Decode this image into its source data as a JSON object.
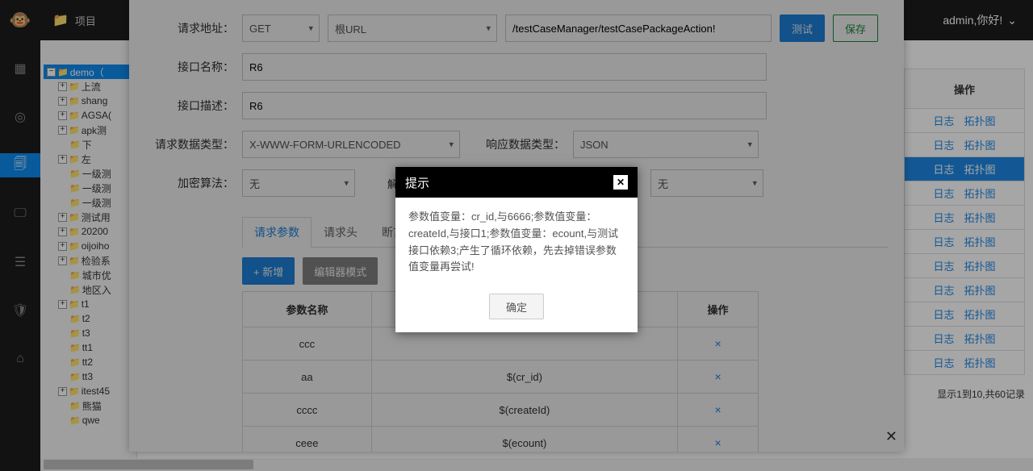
{
  "topbar": {
    "project_label": "项目",
    "user_label": "admin,你好!"
  },
  "rail_icons": [
    "dashboard",
    "target",
    "doc",
    "monitor",
    "list",
    "shield",
    "home"
  ],
  "tree": {
    "root": "demo（",
    "nodes": [
      {
        "label": "上流",
        "children": []
      },
      {
        "label": "shang",
        "children": []
      },
      {
        "label": "AGSA(",
        "children": []
      },
      {
        "label": "apk测",
        "children": [
          {
            "label": "下"
          }
        ]
      },
      {
        "label": "左",
        "children": [
          {
            "label": "一级测"
          },
          {
            "label": "一级测"
          },
          {
            "label": "一级测"
          }
        ]
      },
      {
        "label": "测试用",
        "children": []
      },
      {
        "label": "20200",
        "children": []
      },
      {
        "label": "oijoiho",
        "children": []
      },
      {
        "label": "检验系",
        "children": [
          {
            "label": "城市优"
          },
          {
            "label": "地区入"
          }
        ]
      },
      {
        "label": "t1",
        "children": [
          {
            "label": "t2"
          },
          {
            "label": "t3"
          },
          {
            "label": "tt1"
          },
          {
            "label": "tt2"
          },
          {
            "label": "tt3"
          }
        ]
      },
      {
        "label": "itest45",
        "children": [
          {
            "label": "熊猫"
          },
          {
            "label": "qwe"
          }
        ]
      }
    ]
  },
  "rightpane": {
    "header": "操作",
    "log_label": "日志",
    "topo_label": "拓扑图",
    "row_count": 11,
    "selected_index": 2,
    "pager": "显示1到10,共60记录"
  },
  "form": {
    "url_label": "请求地址：",
    "method": "GET",
    "base_url": "根URL",
    "path": "/testCaseManager/testCasePackageAction!",
    "test_btn": "测试",
    "save_btn": "保存",
    "name_label": "接口名称：",
    "name_value": "R6",
    "desc_label": "接口描述：",
    "desc_value": "R6",
    "req_type_label": "请求数据类型：",
    "req_type_value": "X-WWW-FORM-URLENCODED",
    "res_type_label": "响应数据类型：",
    "res_type_value": "JSON",
    "enc_label": "加密算法：",
    "enc_value": "无",
    "dec_label": "解密",
    "dec2_value": "无"
  },
  "tabs": {
    "t1": "请求参数",
    "t2": "请求头",
    "t3": "断言"
  },
  "toolbar": {
    "add": "+ 新增",
    "editor": "编辑器模式"
  },
  "param_table": {
    "col_name": "参数名称",
    "col_action": "操作",
    "rows": [
      {
        "name": "ccc",
        "value": ""
      },
      {
        "name": "aa",
        "value": "$(cr_id)"
      },
      {
        "name": "cccc",
        "value": "$(createId)"
      },
      {
        "name": "ceee",
        "value": "$(ecount)"
      }
    ]
  },
  "alert": {
    "title": "提示",
    "body": "参数值变量：cr_id,与6666;参数值变量：createId,与接口1;参数值变量：ecount,与测试接口依赖3;产生了循环依赖，先去掉错误参数值变量再尝试!",
    "ok": "确定"
  }
}
